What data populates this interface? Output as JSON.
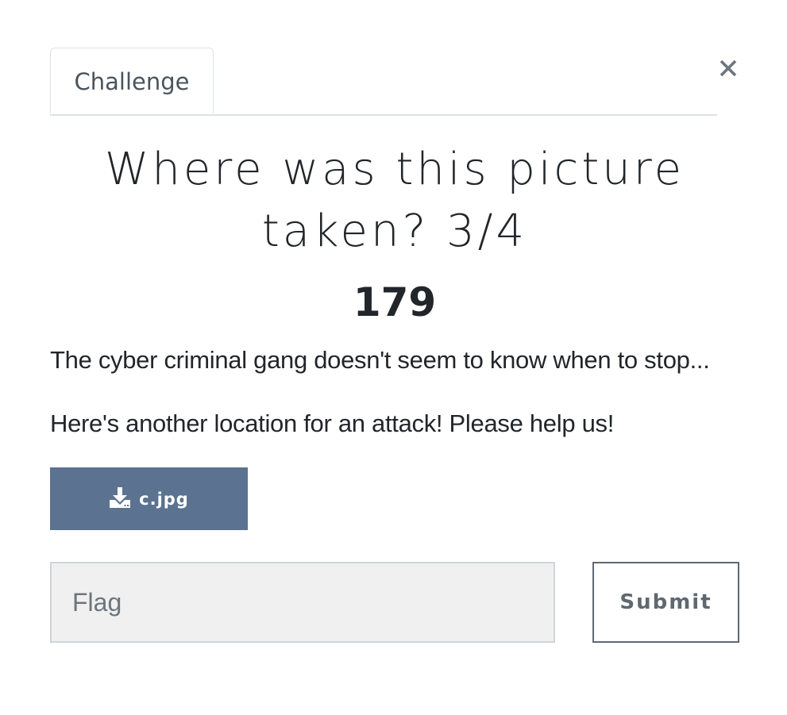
{
  "modal": {
    "close_label": "×"
  },
  "tabs": [
    {
      "label": "Challenge",
      "active": true
    }
  ],
  "challenge": {
    "title": "Where was this picture taken? 3/4",
    "value": "179",
    "description": [
      "The cyber criminal gang doesn't seem to know when to stop...",
      "Here's another location for an attack! Please help us!"
    ]
  },
  "files": [
    {
      "name": "c.jpg",
      "icon": "download-icon"
    }
  ],
  "form": {
    "flag_placeholder": "Flag",
    "flag_value": "",
    "submit_label": "Submit"
  },
  "colors": {
    "download_button_bg": "#5b7290",
    "input_bg": "#f0f0f0",
    "text": "#22262a",
    "muted": "#5f6870"
  }
}
